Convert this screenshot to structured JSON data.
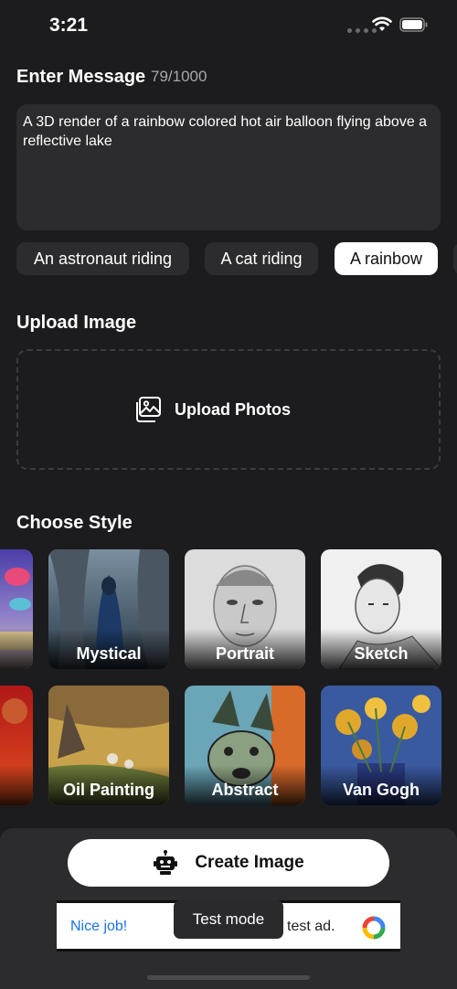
{
  "status_bar": {
    "time": "3:21"
  },
  "message": {
    "label": "Enter Message",
    "counter": "79/1000",
    "text": "A 3D render of a rainbow colored hot air balloon flying above a reflective lake"
  },
  "suggestions": [
    {
      "label": "An astronaut riding",
      "selected": false
    },
    {
      "label": "A cat riding",
      "selected": false
    },
    {
      "label": "A rainbow",
      "selected": true
    }
  ],
  "upload": {
    "label": "Upload Image",
    "button_label": "Upload Photos"
  },
  "styles": {
    "label": "Choose Style",
    "row1": [
      "",
      "Mystical",
      "Portrait",
      "Sketch"
    ],
    "row2": [
      "",
      "Oil Painting",
      "Abstract",
      "Van Gogh"
    ]
  },
  "actions": {
    "create_label": "Create Image"
  },
  "ad": {
    "left_text": "Nice job!",
    "right_text": "test ad.",
    "overlay": "Test mode"
  },
  "colors": {
    "background": "#1c1c1e",
    "surface": "#2c2c2e",
    "ad_link": "#1a73e8"
  }
}
